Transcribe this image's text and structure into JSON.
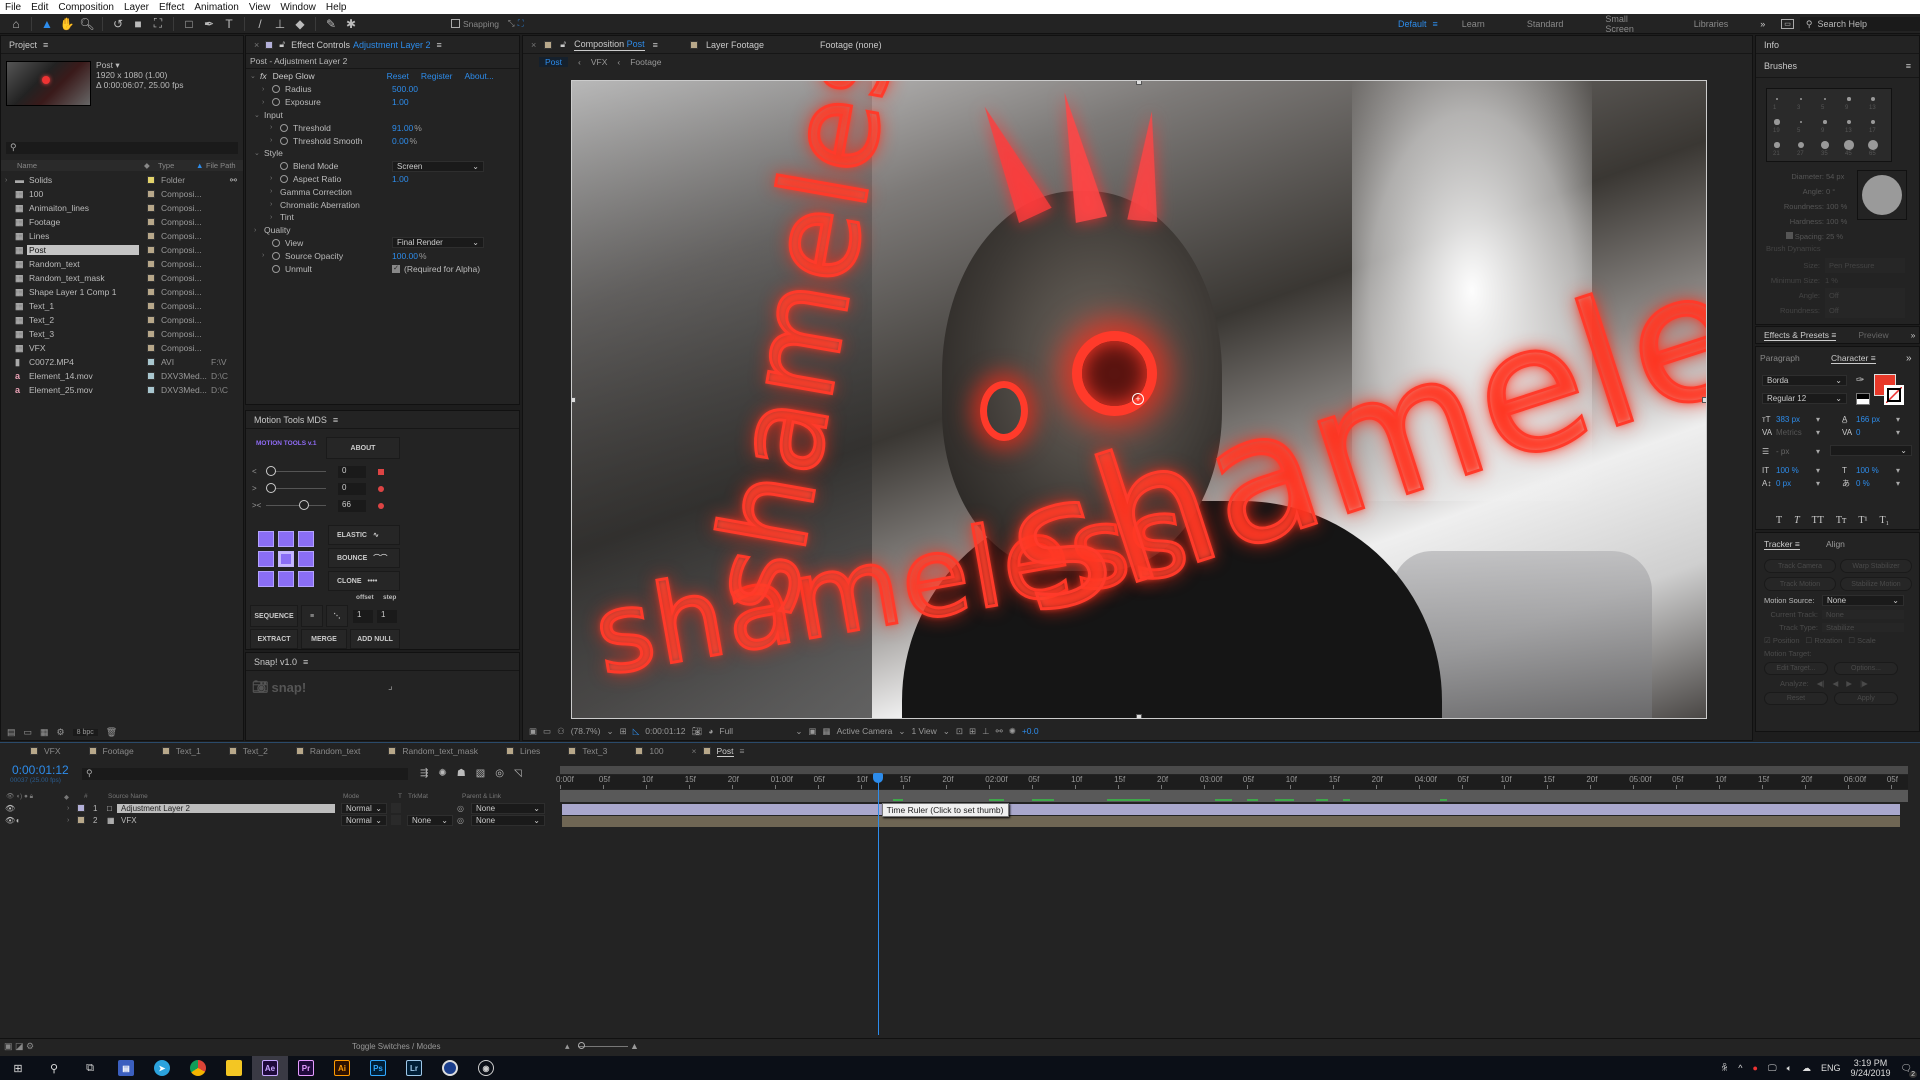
{
  "menu": [
    "File",
    "Edit",
    "Composition",
    "Layer",
    "Effect",
    "Animation",
    "View",
    "Window",
    "Help"
  ],
  "toolbar": {
    "tools": [
      "home-icon",
      "selection-tool-icon",
      "hand-tool-icon",
      "zoom-tool-icon",
      "rotate-tool-icon",
      "camera-tool-icon",
      "pan-behind-tool-icon",
      "rectangle-tool-icon",
      "pen-tool-icon",
      "type-tool-icon",
      "brush-tool-icon",
      "clone-stamp-tool-icon",
      "eraser-tool-icon",
      "roto-brush-tool-icon",
      "puppet-pin-tool-icon"
    ],
    "snapping_label": "Snapping",
    "snapping_checked": false
  },
  "workspaces": {
    "items": [
      "Default",
      "Learn",
      "Standard",
      "Small Screen",
      "Libraries"
    ],
    "active": "Default",
    "more": "»",
    "search_placeholder": "Search Help"
  },
  "project": {
    "title": "Project",
    "preview": {
      "name": "Post ▾",
      "dimensions": "1920 x 1080 (1.00)",
      "duration": "Δ 0:00:06:07, 25.00 fps"
    },
    "search_placeholder": "",
    "columns": {
      "name": "Name",
      "type": "Type",
      "path": "File Path"
    },
    "items": [
      {
        "name": "Solids",
        "type": "Folder",
        "path": "",
        "kind": "folder",
        "color": "#e2d36b"
      },
      {
        "name": "100",
        "type": "Composi...",
        "path": "",
        "kind": "comp",
        "color": "#b8a88a"
      },
      {
        "name": "Animaiton_lines",
        "type": "Composi...",
        "path": "",
        "kind": "comp",
        "color": "#b8a88a"
      },
      {
        "name": "Footage",
        "type": "Composi...",
        "path": "",
        "kind": "comp",
        "color": "#b8a88a"
      },
      {
        "name": "Lines",
        "type": "Composi...",
        "path": "",
        "kind": "comp",
        "color": "#b8a88a"
      },
      {
        "name": "Post",
        "type": "Composi...",
        "path": "",
        "kind": "comp",
        "color": "#b8a88a",
        "selected": true
      },
      {
        "name": "Random_text",
        "type": "Composi...",
        "path": "",
        "kind": "comp",
        "color": "#b8a88a"
      },
      {
        "name": "Random_text_mask",
        "type": "Composi...",
        "path": "",
        "kind": "comp",
        "color": "#b8a88a"
      },
      {
        "name": "Shape Layer 1 Comp 1",
        "type": "Composi...",
        "path": "",
        "kind": "comp",
        "color": "#b8a88a"
      },
      {
        "name": "Text_1",
        "type": "Composi...",
        "path": "",
        "kind": "comp",
        "color": "#b8a88a"
      },
      {
        "name": "Text_2",
        "type": "Composi...",
        "path": "",
        "kind": "comp",
        "color": "#b8a88a"
      },
      {
        "name": "Text_3",
        "type": "Composi...",
        "path": "",
        "kind": "comp",
        "color": "#b8a88a"
      },
      {
        "name": "VFX",
        "type": "Composi...",
        "path": "",
        "kind": "comp",
        "color": "#b8a88a"
      },
      {
        "name": "C0072.MP4",
        "type": "AVI",
        "path": "F:\\V",
        "kind": "video",
        "color": "#a9c7cf"
      },
      {
        "name": "Element_14.mov",
        "type": "DXV3Med...",
        "path": "D:\\C",
        "kind": "mov",
        "color": "#a9c7cf"
      },
      {
        "name": "Element_25.mov",
        "type": "DXV3Med...",
        "path": "D:\\C",
        "kind": "mov",
        "color": "#a9c7cf"
      }
    ],
    "footer": {
      "bpc": "8 bpc"
    }
  },
  "effect_controls": {
    "tab_prefix": "Effect Controls",
    "tab_layer": "Adjustment Layer 2",
    "subtitle": "Post - Adjustment Layer 2",
    "effect": {
      "name": "Deep Glow",
      "reset": "Reset",
      "register": "Register",
      "about": "About..."
    },
    "params": [
      {
        "indent": 1,
        "twirl": true,
        "stopwatch": true,
        "label": "Radius",
        "value": "500.00",
        "unit": ""
      },
      {
        "indent": 1,
        "twirl": true,
        "stopwatch": true,
        "label": "Exposure",
        "value": "1.00",
        "unit": ""
      },
      {
        "indent": 0,
        "twirl": "open",
        "stopwatch": false,
        "label": "Input",
        "value": "",
        "unit": ""
      },
      {
        "indent": 2,
        "twirl": true,
        "stopwatch": true,
        "label": "Threshold",
        "value": "91.00",
        "unit": "%"
      },
      {
        "indent": 2,
        "twirl": true,
        "stopwatch": true,
        "label": "Threshold Smooth",
        "value": "0.00",
        "unit": "%"
      },
      {
        "indent": 0,
        "twirl": "open",
        "stopwatch": false,
        "label": "Style",
        "value": "",
        "unit": ""
      },
      {
        "indent": 2,
        "twirl": false,
        "stopwatch": true,
        "label": "Blend Mode",
        "dropdown": "Screen"
      },
      {
        "indent": 2,
        "twirl": true,
        "stopwatch": true,
        "label": "Aspect Ratio",
        "value": "1.00",
        "unit": ""
      },
      {
        "indent": 2,
        "twirl": true,
        "stopwatch": false,
        "label": "Gamma Correction",
        "value": "",
        "unit": ""
      },
      {
        "indent": 2,
        "twirl": true,
        "stopwatch": false,
        "label": "Chromatic Aberration",
        "value": "",
        "unit": ""
      },
      {
        "indent": 2,
        "twirl": true,
        "stopwatch": false,
        "label": "Tint",
        "value": "",
        "unit": ""
      },
      {
        "indent": 0,
        "twirl": true,
        "stopwatch": false,
        "label": "Quality",
        "value": "",
        "unit": ""
      },
      {
        "indent": 1,
        "twirl": false,
        "stopwatch": true,
        "label": "View",
        "dropdown": "Final Render"
      },
      {
        "indent": 1,
        "twirl": true,
        "stopwatch": true,
        "label": "Source Opacity",
        "value": "100.00",
        "unit": "%"
      },
      {
        "indent": 1,
        "twirl": false,
        "stopwatch": true,
        "label": "Unmult",
        "checkbox": "(Required for Alpha)"
      }
    ]
  },
  "motion_tools": {
    "title": "Motion Tools MDS",
    "logo": "MOTION TOOLS v.1",
    "about": "ABOUT",
    "sliders": [
      {
        "icon": "<",
        "value": "0",
        "fraction": 0.0
      },
      {
        "icon": ">",
        "value": "0",
        "fraction": 0.0
      },
      {
        "icon": "><",
        "value": "66",
        "fraction": 0.66
      }
    ],
    "buttons": {
      "elastic": "ELASTIC",
      "bounce": "BOUNCE",
      "clone": "CLONE",
      "sequence": "SEQUENCE",
      "extract": "EXTRACT",
      "merge": "MERGE",
      "add_null": "ADD NULL"
    },
    "offset_label": "offset",
    "step_label": "step",
    "offset_value": "1",
    "step_value": "1"
  },
  "snap": {
    "title": "Snap! v1.0",
    "logo": "snap!"
  },
  "composition": {
    "tabs": [
      {
        "prefix": "Composition",
        "name": "Post",
        "active": true
      },
      {
        "prefix": "Layer",
        "name": "Footage",
        "active": false
      },
      {
        "prefix": "Footage",
        "name": "(none)",
        "active": false
      }
    ],
    "breadcrumbs": [
      "Post",
      "VFX",
      "Footage"
    ],
    "viewer_text": [
      "shameless",
      "shameless",
      "shameless"
    ],
    "footer": {
      "zoom": "(78.7%)",
      "timecode": "0:00:01:12",
      "resolution": "Full",
      "camera": "Active Camera",
      "views": "1 View",
      "exposure": "+0.0"
    }
  },
  "info_panel": {
    "title": "Info"
  },
  "brushes": {
    "title": "Brushes",
    "sizes": [
      "1",
      "3",
      "5",
      "9",
      "13",
      "19",
      "5",
      "9",
      "13",
      "17",
      "21",
      "27",
      "35",
      "45",
      "65"
    ],
    "diameter": {
      "label": "Diameter:",
      "value": "54 px"
    },
    "angle": {
      "label": "Angle:",
      "value": "0 °"
    },
    "roundness": {
      "label": "Roundness:",
      "value": "100 %"
    },
    "hardness": {
      "label": "Hardness:",
      "value": "100 %"
    },
    "spacing": {
      "label": "Spacing:",
      "value": "25 %",
      "checked": true
    },
    "dynamics_title": "Brush Dynamics",
    "size": {
      "label": "Size:",
      "value": "Pen Pressure"
    },
    "min_size": {
      "label": "Minimum Size:",
      "value": "1 %"
    },
    "dyn_angle": {
      "label": "Angle:",
      "value": "Off"
    },
    "dyn_roundness": {
      "label": "Roundness:",
      "value": "Off"
    }
  },
  "effects_presets": {
    "tabs": [
      "Effects & Presets",
      "Preview"
    ]
  },
  "character": {
    "tabs": [
      "Paragraph",
      "Character"
    ],
    "font": "Borda",
    "style": "Regular 12",
    "fill_color": "#e8392a",
    "font_size": "383 px",
    "leading": "166 px",
    "kerning": "Metrics",
    "tracking": "0",
    "stroke_width": "- px",
    "vertical_scale": "100 %",
    "horizontal_scale": "100 %",
    "baseline_shift": "0 px",
    "tsume": "0 %",
    "style_buttons": [
      "T",
      "T",
      "TT",
      "Tт",
      "T¹",
      "T₁"
    ]
  },
  "tracker": {
    "tabs": [
      "Tracker",
      "Align"
    ],
    "track_camera": "Track Camera",
    "warp_stabilizer": "Warp Stabilizer",
    "track_motion": "Track Motion",
    "stabilize_motion": "Stabilize Motion",
    "motion_source": {
      "label": "Motion Source:",
      "value": "None"
    },
    "current_track": {
      "label": "Current Track:",
      "value": "None"
    },
    "track_type": {
      "label": "Track Type:",
      "value": "Stabilize"
    },
    "position": "Position",
    "rotation": "Rotation",
    "scale": "Scale",
    "motion_target": "Motion Target:",
    "edit_target": "Edit Target...",
    "options": "Options...",
    "analyze": "Analyze:",
    "reset": "Reset",
    "apply": "Apply"
  },
  "timeline": {
    "tabs": [
      "VFX",
      "Footage",
      "Text_1",
      "Text_2",
      "Random_text",
      "Random_text_mask",
      "Lines",
      "Text_3",
      "100",
      "Post"
    ],
    "active_tab": "Post",
    "timecode": "0:00:01:12",
    "frames": "00037 (25.00 fps)",
    "columns": {
      "source_name": "Source Name",
      "mode": "Mode",
      "t": "T",
      "trkmat": "TrkMat",
      "parent": "Parent & Link"
    },
    "layers": [
      {
        "num": "1",
        "name": "Adjustment Layer 2",
        "mode": "Normal",
        "trkmat": "",
        "parent": "None",
        "label_color": "#b3b0d9",
        "selected": true
      },
      {
        "num": "2",
        "name": "VFX",
        "mode": "Normal",
        "trkmat": "None",
        "parent": "None",
        "label_color": "#b8a88a",
        "selected": false
      }
    ],
    "ruler_labels": [
      "0:00f",
      "05f",
      "10f",
      "15f",
      "20f",
      "01:00f",
      "05f",
      "10f",
      "15f",
      "20f",
      "02:00f",
      "05f",
      "10f",
      "15f",
      "20f",
      "03:00f",
      "05f",
      "10f",
      "15f",
      "20f",
      "04:00f",
      "05f",
      "10f",
      "15f",
      "20f",
      "05:00f",
      "05f",
      "10f",
      "15f",
      "20f",
      "06:00f",
      "05f"
    ],
    "playhead_seconds": 1.48,
    "duration_seconds": 6.28,
    "tooltip": "Time Ruler (Click to set thumb)",
    "toggle_label": "Toggle Switches / Modes"
  },
  "taskbar": {
    "apps": [
      "start-icon",
      "search-icon",
      "task-view-icon",
      "save-app-icon",
      "telegram-icon",
      "chrome-icon",
      "file-explorer-icon",
      "Ae",
      "Pr",
      "Ai",
      "Ps",
      "Lr",
      "cinema4d-icon",
      "obs-icon"
    ],
    "language": "ENG",
    "time": "3:19 PM",
    "date": "9/24/2019",
    "notifications": "2"
  }
}
